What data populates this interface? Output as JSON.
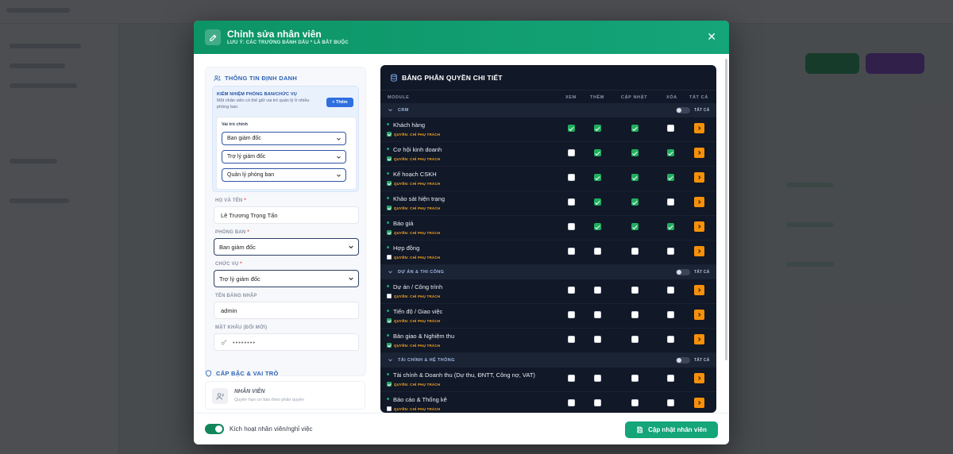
{
  "modal": {
    "title": "Chỉnh sửa nhân viên",
    "subtitle": "LƯU Ý: CÁC TRƯỜNG ĐÁNH DẤU * LÀ BẮT BUỘC",
    "close_symbol": "✕",
    "colors": {
      "header": "#0d9466",
      "accent": "#14a578",
      "table_bg": "#111827",
      "warning": "#f79009"
    }
  },
  "identity": {
    "section_title": "THÔNG TIN ĐỊNH DANH",
    "multi_role": {
      "title": "KIÊM NHIỆM PHÒNG BAN/CHỨC VỤ",
      "description": "Một nhân viên có thể giữ vai trò quản lý ở nhiều phòng ban.",
      "add_label": "+ Thêm",
      "main_role_label": "Vai trò chính",
      "selects": [
        "Ban giám đốc",
        "Trợ lý giám đốc",
        "Quản lý phòng ban"
      ]
    },
    "fullname": {
      "label": "HỌ VÀ TÊN",
      "required": "*",
      "value": "Lê Trương Trọng Tấn"
    },
    "department": {
      "label": "PHÒNG BAN",
      "required": "*",
      "value": "Ban giám đốc"
    },
    "position": {
      "label": "CHỨC VỤ",
      "required": "*",
      "value": "Trợ lý giám đốc"
    },
    "username": {
      "label": "TÊN ĐĂNG NHẬP",
      "value": "admin"
    },
    "password": {
      "label": "MẬT KHẨU (ĐỔI MỚI)",
      "value": "••••••••"
    }
  },
  "rank": {
    "section_title": "CẤP BẬC & VAI TRÒ",
    "role_name": "NHÂN VIÊN",
    "role_desc": "Quyền hạn cơ bản theo phân quyền"
  },
  "permissions": {
    "title": "BẢNG PHÂN QUYỀN CHI TIẾT",
    "columns": [
      "MODULE",
      "XEM",
      "THÊM",
      "CẬP NHẬT",
      "XÓA",
      "TẤT CẢ"
    ],
    "owner_label": "QUYỀN: CHỈ PHỤ TRÁCH",
    "all_label": "TẤT CẢ",
    "groups": [
      {
        "name": "CRM",
        "rows": [
          {
            "name": "Khách hàng",
            "owner": true,
            "perms": [
              true,
              true,
              true,
              false
            ]
          },
          {
            "name": "Cơ hội kinh doanh",
            "owner": true,
            "perms": [
              false,
              true,
              true,
              true
            ]
          },
          {
            "name": "Kế hoạch CSKH",
            "owner": true,
            "perms": [
              false,
              true,
              true,
              true
            ]
          },
          {
            "name": "Khảo sát hiện trạng",
            "owner": true,
            "perms": [
              false,
              true,
              true,
              false
            ]
          },
          {
            "name": "Báo giá",
            "owner": true,
            "perms": [
              false,
              true,
              true,
              true
            ]
          },
          {
            "name": "Hợp đồng",
            "owner": false,
            "perms": [
              false,
              false,
              false,
              false
            ]
          }
        ]
      },
      {
        "name": "DỰ ÁN & THI CÔNG",
        "rows": [
          {
            "name": "Dự án / Công trình",
            "owner": false,
            "perms": [
              false,
              false,
              false,
              false
            ]
          },
          {
            "name": "Tiến độ / Giao việc",
            "owner": true,
            "perms": [
              false,
              false,
              false,
              false
            ]
          },
          {
            "name": "Bàn giao & Nghiệm thu",
            "owner": true,
            "perms": [
              false,
              false,
              false,
              false
            ]
          }
        ]
      },
      {
        "name": "TÀI CHÍNH & HỆ THỐNG",
        "rows": [
          {
            "name": "Tài chính & Doanh thu (Dự thu, ĐNTT, Công nợ, VAT)",
            "owner": true,
            "perms": [
              false,
              false,
              false,
              false
            ]
          },
          {
            "name": "Báo cáo & Thống kê",
            "owner": false,
            "perms": [
              false,
              false,
              false,
              false
            ]
          }
        ]
      }
    ]
  },
  "footer": {
    "toggle_label": "Kích hoạt nhân viên/nghỉ việc",
    "toggle_on": true,
    "save_label": "Cập nhật nhân viên"
  }
}
